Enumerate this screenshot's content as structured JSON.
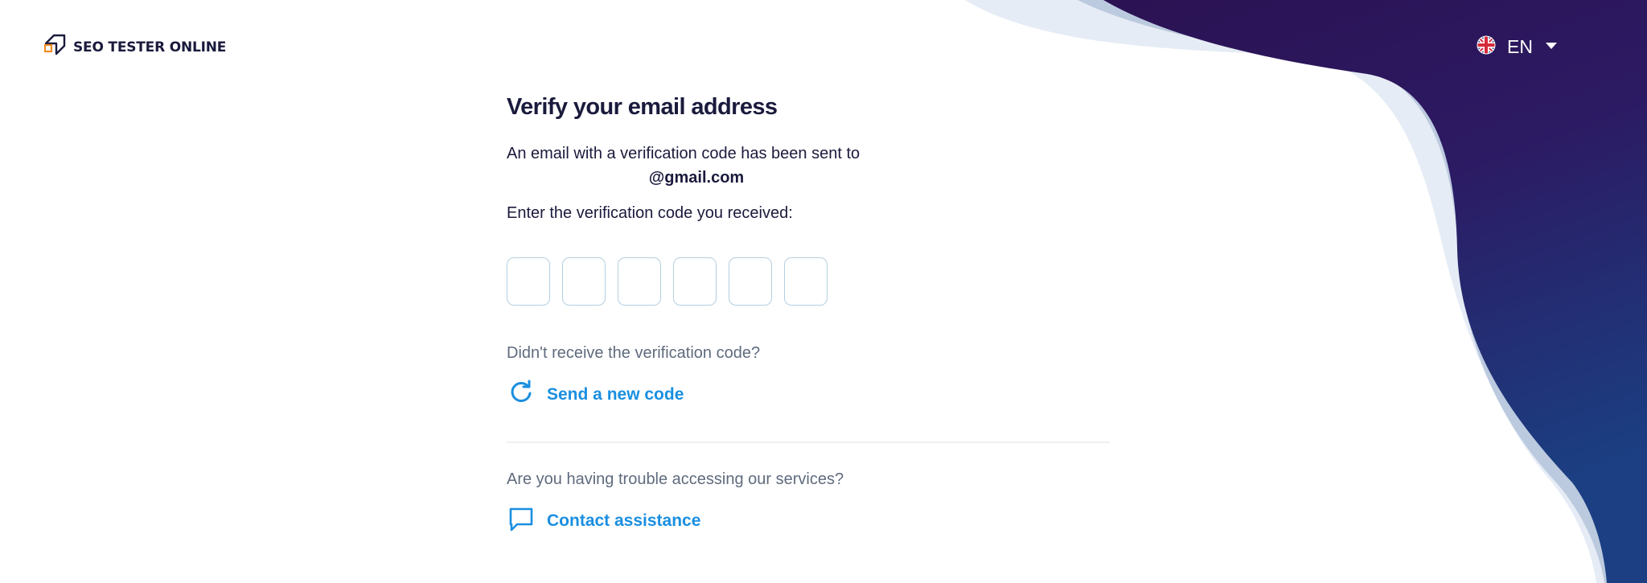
{
  "header": {
    "logo_text": "SEO TESTER ONLINE",
    "language": {
      "label": "EN",
      "flag_icon": "uk-flag-icon",
      "dropdown_icon": "caret-down-icon"
    }
  },
  "main": {
    "title": "Verify your email address",
    "sent_message": "An email with a verification code has been sent to",
    "email": "@gmail.com",
    "enter_prompt": "Enter the verification code you received:",
    "code_fields": [
      "",
      "",
      "",
      "",
      "",
      ""
    ],
    "resend": {
      "question": "Didn't receive the verification code?",
      "action_label": "Send a new code",
      "icon": "refresh-icon"
    },
    "support": {
      "question": "Are you having trouble accessing our services?",
      "action_label": "Contact assistance",
      "icon": "chat-bubble-icon"
    }
  },
  "colors": {
    "accent": "#1a8fe0",
    "text_dark": "#1a1a3d",
    "text_muted": "#5f6b7d",
    "brand_purple": "#2a1150",
    "brand_navy": "#1c3c80",
    "wave_light": "#e6ecf5",
    "wave_mid": "#bccadf",
    "logo_orange": "#f08c28"
  }
}
